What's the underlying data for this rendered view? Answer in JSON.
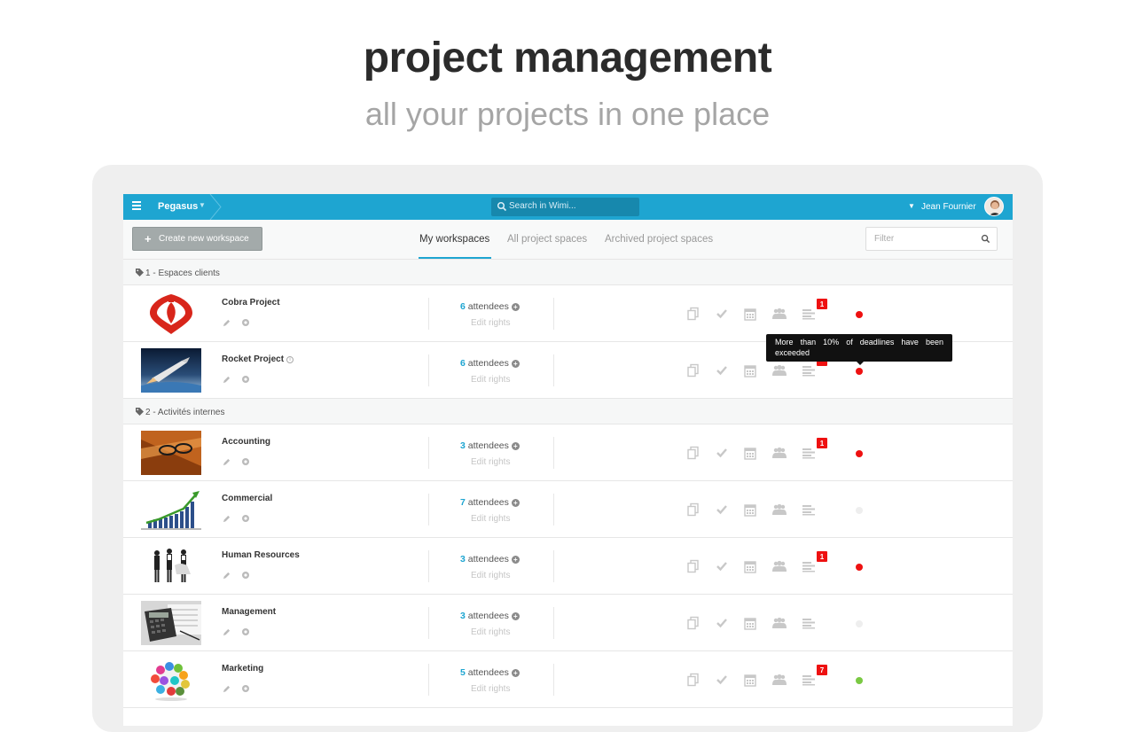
{
  "hero": {
    "title": "project management",
    "subtitle": "all your projects in one place"
  },
  "topbar": {
    "workspace_name": "Pegasus",
    "search_placeholder": "Search in Wimi...",
    "user_name": "Jean Fournier",
    "accent_color": "#1ea5d1"
  },
  "toolbar": {
    "create_label": "Create new workspace",
    "tabs": [
      "My workspaces",
      "All project spaces",
      "Archived project spaces"
    ],
    "active_tab": "My workspaces",
    "filter_placeholder": "Filter"
  },
  "groups": [
    {
      "label": "1 - Espaces clients",
      "rows": [
        {
          "name": "Cobra Project",
          "attendees_count": "6",
          "attendees_label": "attendees",
          "rights_label": "Edit rights",
          "badge": "1",
          "status": "red",
          "image": "cobra-logo"
        },
        {
          "name": "Rocket Project",
          "attendees_count": "6",
          "attendees_label": "attendees",
          "rights_label": "Edit rights",
          "badge": "",
          "status": "red",
          "image": "rocket-photo"
        }
      ]
    },
    {
      "label": "2 - Activités internes",
      "rows": [
        {
          "name": "Accounting",
          "attendees_count": "3",
          "attendees_label": "attendees",
          "rights_label": "Edit rights",
          "badge": "1",
          "status": "red",
          "image": "accounting-photo"
        },
        {
          "name": "Commercial",
          "attendees_count": "7",
          "attendees_label": "attendees",
          "rights_label": "Edit rights",
          "badge": "",
          "status": "none",
          "image": "growth-chart-photo"
        },
        {
          "name": "Human Resources",
          "attendees_count": "3",
          "attendees_label": "attendees",
          "rights_label": "Edit rights",
          "badge": "1",
          "status": "red",
          "image": "people-photo"
        },
        {
          "name": "Management",
          "attendees_count": "3",
          "attendees_label": "attendees",
          "rights_label": "Edit rights",
          "badge": "",
          "status": "none",
          "image": "calculator-photo"
        },
        {
          "name": "Marketing",
          "attendees_count": "5",
          "attendees_label": "attendees",
          "rights_label": "Edit rights",
          "badge": "7",
          "status": "green",
          "image": "social-icons-photo"
        }
      ]
    }
  ],
  "tooltip": {
    "text": "More than 10% of deadlines have been exceeded"
  },
  "colors": {
    "status_red": "#ee1111",
    "status_green": "#7ac943",
    "status_none": "#eeeeee",
    "icon_gray": "#c8c8c8"
  }
}
